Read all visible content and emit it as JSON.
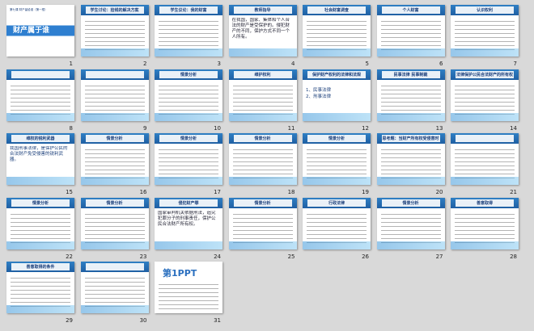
{
  "slides": [
    {
      "n": "1",
      "title": "财产属于谁",
      "sub": "第七课 财产留给谁（第一框）",
      "kind": "cover"
    },
    {
      "n": "2",
      "title": "学生讨论：捡钱的解决方案",
      "kind": "text"
    },
    {
      "n": "3",
      "title": "学生议论：我的财富",
      "kind": "text"
    },
    {
      "n": "4",
      "title": "教师指导",
      "body": "在我国，国家、集体和个人合法的财产是受保护的。侵犯财产的不同，保护方式不同一个人所有。",
      "kind": "big"
    },
    {
      "n": "5",
      "title": "社会财富调查",
      "kind": "diagram"
    },
    {
      "n": "6",
      "title": "个人财富",
      "kind": "text"
    },
    {
      "n": "7",
      "title": "认识权利",
      "kind": "text"
    },
    {
      "n": "8",
      "title": "",
      "kind": "pics"
    },
    {
      "n": "9",
      "title": "",
      "kind": "list"
    },
    {
      "n": "10",
      "title": "情景分析",
      "kind": "text"
    },
    {
      "n": "11",
      "title": "维护权利",
      "kind": "text"
    },
    {
      "n": "12",
      "title": "保护财产权利的法律和法规",
      "items": [
        "1、民事法律",
        "2、刑事法律"
      ],
      "kind": "law"
    },
    {
      "n": "13",
      "title": "民事法律 民事制裁",
      "kind": "text"
    },
    {
      "n": "14",
      "title": "法律保护公民合法财产的所有权",
      "kind": "text"
    },
    {
      "n": "15",
      "title": "维权的锐利武器",
      "body": "我国刑事法律，是保护公民的合法财产免受侵害的锐利武器。",
      "kind": "big2"
    },
    {
      "n": "16",
      "title": "情景分析",
      "kind": "text"
    },
    {
      "n": "17",
      "title": "情景分析",
      "kind": "text"
    },
    {
      "n": "18",
      "title": "情景分析",
      "kind": "text"
    },
    {
      "n": "19",
      "title": "情景分析",
      "kind": "text"
    },
    {
      "n": "20",
      "title": "思考题：当财产所有权受侵害时",
      "kind": "text"
    },
    {
      "n": "21",
      "title": "",
      "kind": "diagram"
    },
    {
      "n": "22",
      "title": "情景分析",
      "kind": "text"
    },
    {
      "n": "23",
      "title": "情景分析",
      "kind": "text"
    },
    {
      "n": "24",
      "title": "侵犯财产罪",
      "body": "国家审判机关依据刑法，追究犯罪分子的刑事责任，保护公民合法财产所有权。",
      "kind": "big"
    },
    {
      "n": "25",
      "title": "情景分析",
      "kind": "text"
    },
    {
      "n": "26",
      "title": "行政法律",
      "kind": "text"
    },
    {
      "n": "27",
      "title": "情景分析",
      "kind": "text"
    },
    {
      "n": "28",
      "title": "善意取得",
      "kind": "text"
    },
    {
      "n": "29",
      "title": "善意取得的条件",
      "kind": "text"
    },
    {
      "n": "30",
      "title": "",
      "kind": "text"
    },
    {
      "n": "31",
      "title": "第1PPT",
      "kind": "logo"
    }
  ]
}
